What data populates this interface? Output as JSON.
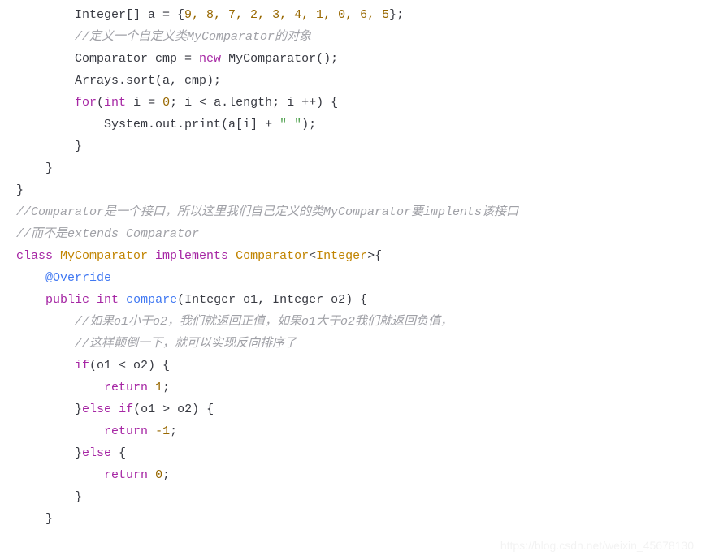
{
  "code": {
    "l1_decl": "Integer[] a = {",
    "l1_nums": "9, 8, 7, 2, 3, 4, 1, 0, 6, 5",
    "l1_end": "};",
    "l2_comment": "//定义一个自定义类MyComparator的对象",
    "l3_a": "Comparator cmp = ",
    "l3_new": "new",
    "l3_b": " MyComparator();",
    "l4": "Arrays.sort(a, cmp);",
    "l5_for": "for",
    "l5_a": "(",
    "l5_int": "int",
    "l5_b": " i = ",
    "l5_zero": "0",
    "l5_c": "; i < a.length; i ++) {",
    "l6_a": "System.out.print(a[i] + ",
    "l6_str": "\" \"",
    "l6_b": ");",
    "l7": "}",
    "l8": "}",
    "l9": "}",
    "l10_comment": "//Comparator是一个接口，所以这里我们自己定义的类MyComparator要implents该接口",
    "l11_comment": "//而不是extends Comparator",
    "l12_class": "class",
    "l12_name": " MyComparator ",
    "l12_impl": "implements",
    "l12_comp": " Comparator",
    "l12_lt": "<",
    "l12_integer": "Integer",
    "l12_gt": ">{",
    "l13_override": "@Override",
    "l14_public": "public",
    "l14_sp1": " ",
    "l14_int": "int",
    "l14_sp2": " ",
    "l14_compare": "compare",
    "l14_a": "(Integer o1, Integer o2) {",
    "l15_comment": "//如果o1小于o2，我们就返回正值，如果o1大于o2我们就返回负值，",
    "l16_comment": "//这样颠倒一下，就可以实现反向排序了",
    "l17_if": "if",
    "l17_a": "(o1 < o2) {",
    "l18_return": "return",
    "l18_sp": " ",
    "l18_num": "1",
    "l18_b": ";",
    "l19_a": "}",
    "l19_else": "else",
    "l19_sp": " ",
    "l19_if": "if",
    "l19_b": "(o1 > o2) {",
    "l20_return": "return",
    "l20_sp": " ",
    "l20_num": "-1",
    "l20_b": ";",
    "l21_a": "}",
    "l21_else": "else",
    "l21_b": " {",
    "l22_return": "return",
    "l22_sp": " ",
    "l22_num": "0",
    "l22_b": ";",
    "l23": "}",
    "l24": "}"
  },
  "watermark": "https://blog.csdn.net/weixin_45678130"
}
